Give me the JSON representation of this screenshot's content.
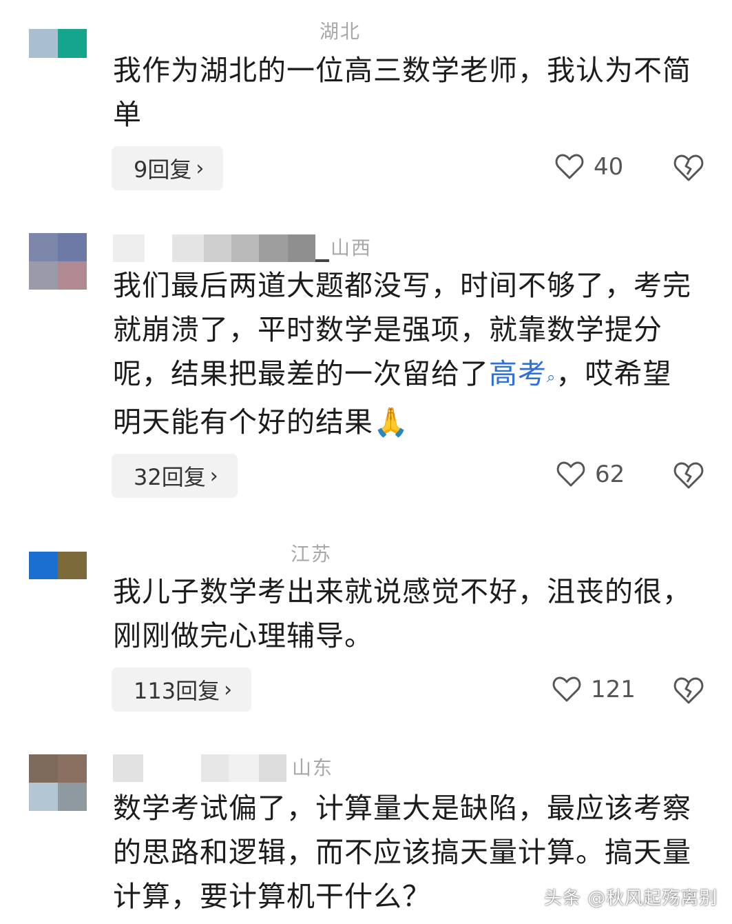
{
  "comments": [
    {
      "location": "湖北",
      "text": "我作为湖北的一位高三数学老师，我认为不简单",
      "replies": "9回复",
      "likes": "40"
    },
    {
      "location": "山西",
      "text_before": "我们最后两道大题都没写，时间不够了，考完就崩溃了，平时数学是强项，就靠数学提分呢，结果把最差的一次留给了",
      "link": "高考",
      "text_after": "，哎希望明天能有个好的结果",
      "emoji": "🙏",
      "replies": "32回复",
      "likes": "62"
    },
    {
      "location": "江苏",
      "text": "我儿子数学考出来就说感觉不好，沮丧的很，刚刚做完心理辅导。",
      "replies": "113回复",
      "likes": "121"
    },
    {
      "location": "山东",
      "text": "数学考试偏了，计算量大是缺陷，最应该考察的思路和逻辑，而不应该搞天量计算。搞天量计算，要计算机干什么？"
    }
  ],
  "icons": {
    "like": "heart-icon",
    "dislike": "broken-heart-icon",
    "chevron": "chevron-right-icon",
    "search_mark": "search-icon"
  },
  "colors": {
    "link": "#2f6fd6",
    "location": "#a8a8a8",
    "reply_bg": "#f2f2f2"
  },
  "watermark": "头条 @秋风起殇离别"
}
